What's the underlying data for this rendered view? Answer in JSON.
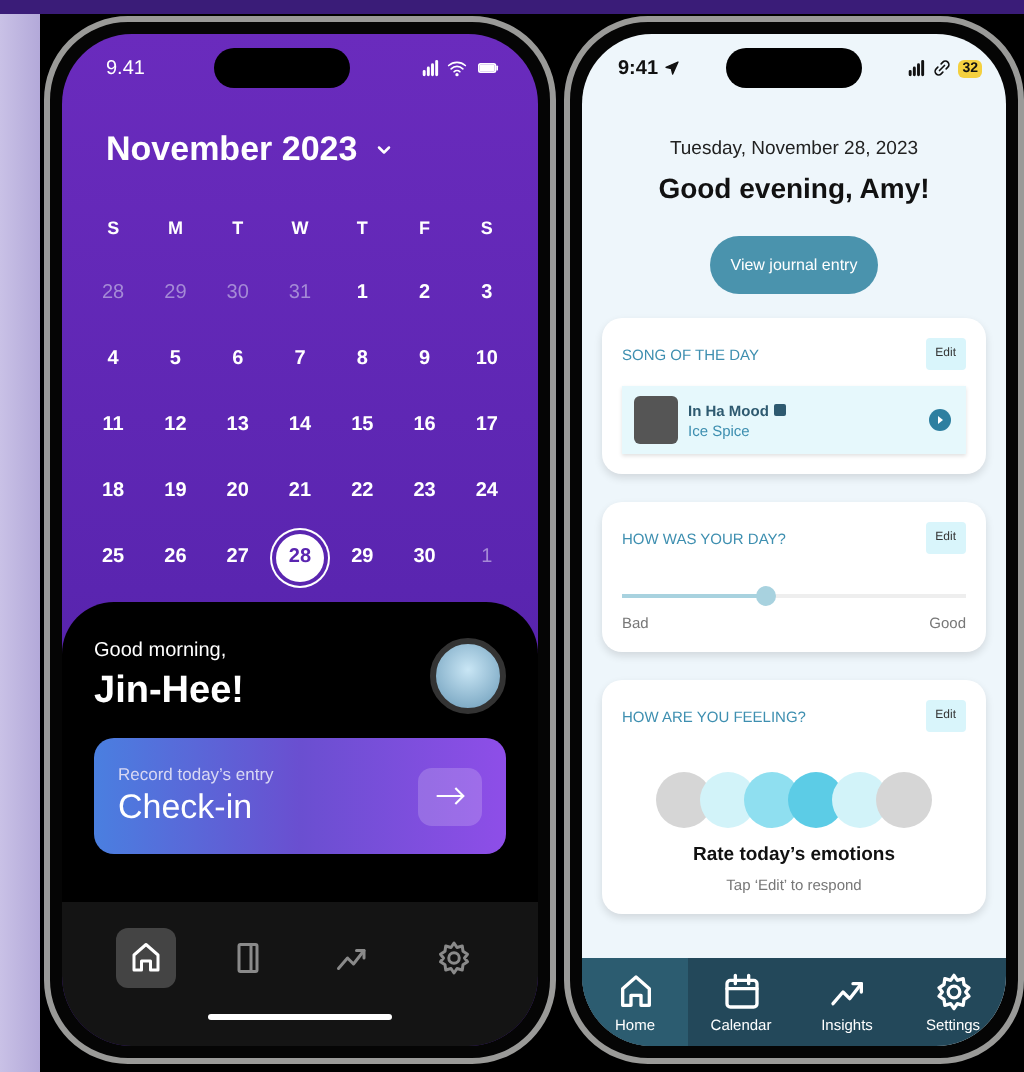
{
  "left_phone": {
    "status_time": "9.41",
    "calendar": {
      "month_title": "November 2023",
      "weekdays": [
        "S",
        "M",
        "T",
        "W",
        "T",
        "F",
        "S"
      ],
      "days": [
        {
          "label": "28",
          "kind": "outside",
          "selected": false
        },
        {
          "label": "29",
          "kind": "outside",
          "selected": false
        },
        {
          "label": "30",
          "kind": "outside",
          "selected": false
        },
        {
          "label": "31",
          "kind": "outside",
          "selected": false
        },
        {
          "label": "1",
          "kind": "current",
          "selected": false
        },
        {
          "label": "2",
          "kind": "current",
          "selected": false
        },
        {
          "label": "3",
          "kind": "current",
          "selected": false
        },
        {
          "label": "4",
          "kind": "current",
          "selected": false
        },
        {
          "label": "5",
          "kind": "current",
          "selected": false
        },
        {
          "label": "6",
          "kind": "current",
          "selected": false
        },
        {
          "label": "7",
          "kind": "current",
          "selected": false
        },
        {
          "label": "8",
          "kind": "current",
          "selected": false
        },
        {
          "label": "9",
          "kind": "current",
          "selected": false
        },
        {
          "label": "10",
          "kind": "current",
          "selected": false
        },
        {
          "label": "11",
          "kind": "current",
          "selected": false
        },
        {
          "label": "12",
          "kind": "current",
          "selected": false
        },
        {
          "label": "13",
          "kind": "current",
          "selected": false
        },
        {
          "label": "14",
          "kind": "current",
          "selected": false
        },
        {
          "label": "15",
          "kind": "current",
          "selected": false
        },
        {
          "label": "16",
          "kind": "current",
          "selected": false
        },
        {
          "label": "17",
          "kind": "current",
          "selected": false
        },
        {
          "label": "18",
          "kind": "current",
          "selected": false
        },
        {
          "label": "19",
          "kind": "current",
          "selected": false
        },
        {
          "label": "20",
          "kind": "current",
          "selected": false
        },
        {
          "label": "21",
          "kind": "current",
          "selected": false
        },
        {
          "label": "22",
          "kind": "current",
          "selected": false
        },
        {
          "label": "23",
          "kind": "current",
          "selected": false
        },
        {
          "label": "24",
          "kind": "current",
          "selected": false
        },
        {
          "label": "25",
          "kind": "current",
          "selected": false
        },
        {
          "label": "26",
          "kind": "current",
          "selected": false
        },
        {
          "label": "27",
          "kind": "current",
          "selected": false
        },
        {
          "label": "28",
          "kind": "current",
          "selected": true
        },
        {
          "label": "29",
          "kind": "current",
          "selected": false
        },
        {
          "label": "30",
          "kind": "current",
          "selected": false
        },
        {
          "label": "1",
          "kind": "outside",
          "selected": false
        }
      ]
    },
    "greeting": "Good morning,",
    "name": "Jin-Hee!",
    "checkin": {
      "caption": "Record today’s entry",
      "title": "Check-in"
    },
    "nav": [
      {
        "kind": "home",
        "selected": true
      },
      {
        "kind": "journal",
        "selected": false
      },
      {
        "kind": "insights",
        "selected": false
      },
      {
        "kind": "settings",
        "selected": false
      }
    ]
  },
  "right_phone": {
    "status_time": "9:41",
    "battery": "32",
    "date": "Tuesday, November 28, 2023",
    "greeting": "Good evening, Amy!",
    "journal_button": "View journal entry",
    "cards": [
      {
        "kind": "song",
        "title": "SONG OF THE DAY",
        "edit": "Edit",
        "song": "In Ha Mood",
        "artist": "Ice Spice"
      },
      {
        "kind": "slider",
        "title": "HOW WAS YOUR DAY?",
        "edit": "Edit",
        "level": 0.42,
        "min_label": "Bad",
        "max_label": "Good"
      },
      {
        "kind": "emotions",
        "title": "HOW ARE YOU FEELING?",
        "edit": "Edit",
        "emotions": [
          {
            "color": "#d6d6d6"
          },
          {
            "color": "#d2f3f9"
          },
          {
            "color": "#8fdff0"
          },
          {
            "color": "#5ccce6"
          },
          {
            "color": "#d2f3f9"
          },
          {
            "color": "#d6d6d6"
          }
        ],
        "heading": "Rate today’s emotions",
        "hint": "Tap ‘Edit’ to respond"
      }
    ],
    "nav": [
      {
        "kind": "home",
        "label": "Home",
        "selected": true
      },
      {
        "kind": "calendar",
        "label": "Calendar",
        "selected": false
      },
      {
        "kind": "insights",
        "label": "Insights",
        "selected": false
      },
      {
        "kind": "settings",
        "label": "Settings",
        "selected": false
      }
    ]
  }
}
